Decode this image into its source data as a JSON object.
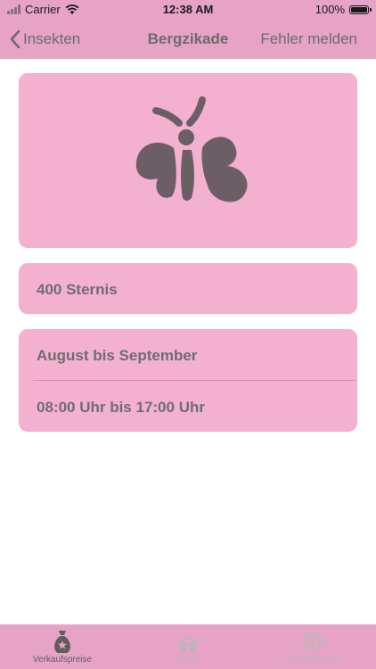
{
  "status": {
    "carrier": "Carrier",
    "time": "12:38 AM",
    "battery": "100%"
  },
  "nav": {
    "back_label": "Insekten",
    "title": "Bergzikade",
    "right_label": "Fehler melden"
  },
  "insect": {
    "icon": "butterfly-icon",
    "price": "400 Sternis",
    "months": "August bis September",
    "hours": "08:00 Uhr bis 17:00 Uhr"
  },
  "tabs": [
    {
      "label": "Verkaufspreise",
      "icon": "money-bag-icon",
      "active": true
    },
    {
      "label": "Haus",
      "icon": "house-icon",
      "active": false
    },
    {
      "label": "Einstellungen",
      "icon": "gear-icon",
      "active": false
    }
  ],
  "colors": {
    "bar": "#e7a3c5",
    "card": "#f4b0cf",
    "text": "#6e6e6e",
    "icon": "#6b5f65"
  }
}
